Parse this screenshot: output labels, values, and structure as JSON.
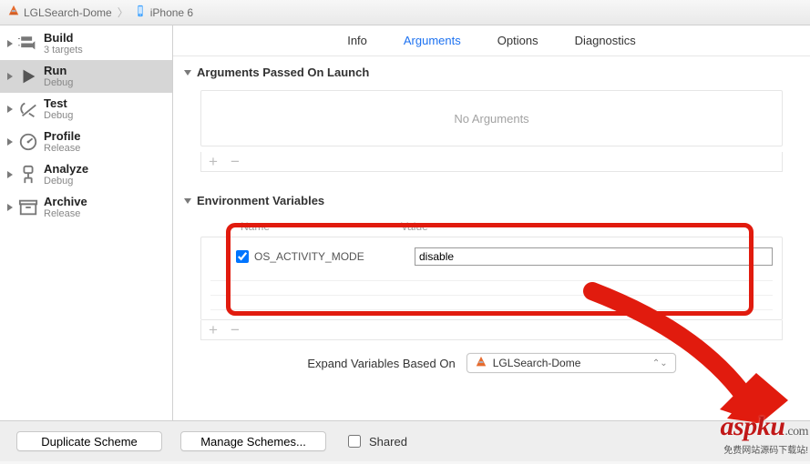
{
  "breadcrumb": {
    "app": "LGLSearch-Dome",
    "target": "iPhone 6"
  },
  "sidebar": {
    "items": [
      {
        "title": "Build",
        "sub": "3 targets"
      },
      {
        "title": "Run",
        "sub": "Debug"
      },
      {
        "title": "Test",
        "sub": "Debug"
      },
      {
        "title": "Profile",
        "sub": "Release"
      },
      {
        "title": "Analyze",
        "sub": "Debug"
      },
      {
        "title": "Archive",
        "sub": "Release"
      }
    ]
  },
  "tabs": {
    "info": "Info",
    "arguments": "Arguments",
    "options": "Options",
    "diagnostics": "Diagnostics"
  },
  "sections": {
    "args_title": "Arguments Passed On Launch",
    "args_empty": "No Arguments",
    "env_title": "Environment Variables",
    "env_head_name": "Name",
    "env_head_value": "Value"
  },
  "env_var": {
    "name": "OS_ACTIVITY_MODE",
    "value": "disable",
    "checked": true
  },
  "expand": {
    "label": "Expand Variables Based On",
    "selected": "LGLSearch-Dome"
  },
  "bottom": {
    "duplicate": "Duplicate Scheme",
    "manage": "Manage Schemes...",
    "shared": "Shared"
  },
  "watermark": {
    "brand": "aspku",
    "dotcom": ".com",
    "tagline": "免费网站源码下载站!"
  }
}
